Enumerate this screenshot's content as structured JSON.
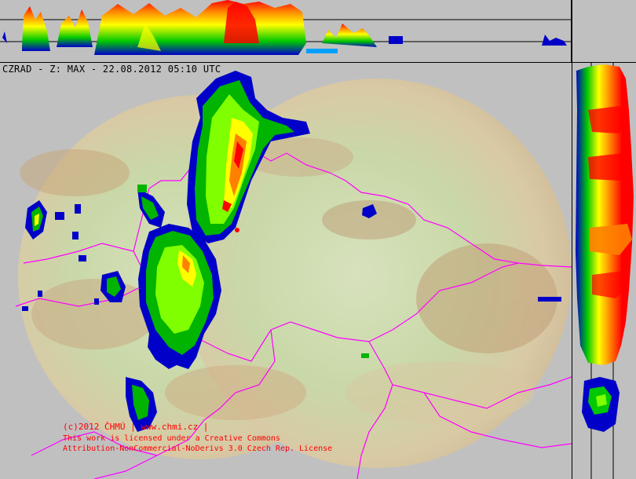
{
  "header": {
    "title": "CZRAD - Z: MAX - 22.08.2012 05:10 UTC"
  },
  "credits": {
    "copyright": "(c)2012 ČHMÚ | www.chmi.cz |",
    "license_line_1": "This work is licensed under a Creative Commons",
    "license_line_2": "Attribution-NonCommercial-NoDerivs 3.0 Czech Rep. License"
  },
  "colors": {
    "background": "#c0c0c0",
    "credit_text": "#ff0000",
    "border_lines": "#ff00ff",
    "radar_low": "#0000c8",
    "radar_mid": "#00c800",
    "radar_high": "#ffff00",
    "radar_max": "#ff0000"
  },
  "icons": {
    "radar_site_marker": "red-dot-marker"
  }
}
